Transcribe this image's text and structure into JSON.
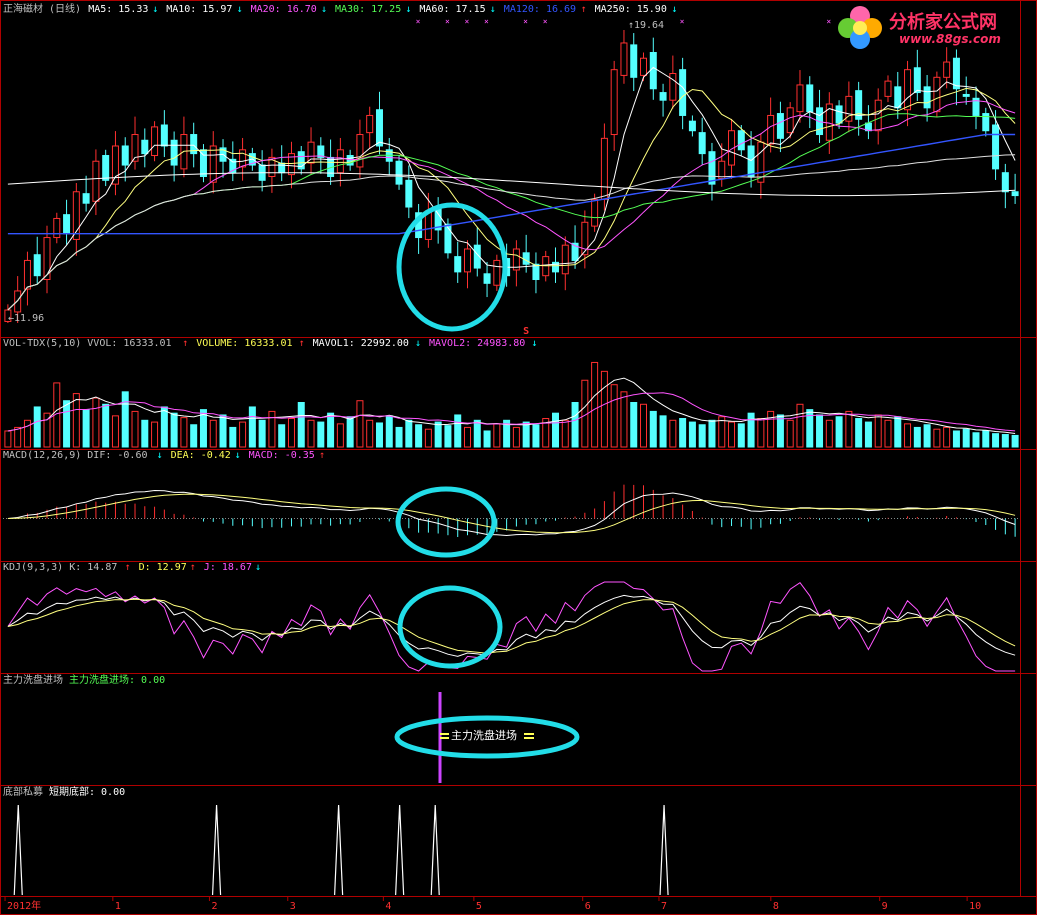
{
  "panels": {
    "price": {
      "legend": [
        {
          "text": "正海磁材 (日线)",
          "color": "#c0c0c0"
        },
        {
          "text": "MA5: 15.33",
          "color": "#ffffff",
          "arrow": "↓",
          "arrow_color": "#00ffff"
        },
        {
          "text": "MA10: 15.97",
          "color": "#ffffff",
          "arrow": "↓",
          "arrow_color": "#00ffff"
        },
        {
          "text": "MA20: 16.70",
          "color": "#ff55ff",
          "arrow": "↓",
          "arrow_color": "#00ffff"
        },
        {
          "text": "MA30: 17.25",
          "color": "#55ff55",
          "arrow": "↓",
          "arrow_color": "#00ffff"
        },
        {
          "text": "MA60: 17.15",
          "color": "#ffffff",
          "arrow": "↓",
          "arrow_color": "#00ffff"
        },
        {
          "text": "MA120: 16.69",
          "color": "#3355ff",
          "arrow": "↑",
          "arrow_color": "#ff3030"
        },
        {
          "text": "MA250: 15.90",
          "color": "#ffffff",
          "arrow": "↓",
          "arrow_color": "#00ffff"
        }
      ],
      "high_label": "19.64",
      "low_label": "11.96",
      "signal_mark": "S"
    },
    "volume": {
      "legend": [
        {
          "text": "VOL-TDX(5,10) VVOL: 16333.01",
          "color": "#c0c0c0",
          "arrow": "↑",
          "arrow_color": "#ff3030"
        },
        {
          "text": "VOLUME: 16333.01",
          "color": "#ffff55",
          "arrow": "↑",
          "arrow_color": "#ff3030"
        },
        {
          "text": "MAVOL1: 22992.00",
          "color": "#ffffff",
          "arrow": "↓",
          "arrow_color": "#00ffff"
        },
        {
          "text": "MAVOL2: 24983.80",
          "color": "#ff55ff",
          "arrow": "↓",
          "arrow_color": "#00ffff"
        }
      ]
    },
    "macd": {
      "legend": [
        {
          "text": "MACD(12,26,9) DIF: -0.60",
          "color": "#c0c0c0",
          "arrow": "↓",
          "arrow_color": "#00ffff"
        },
        {
          "text": "DEA: -0.42",
          "color": "#ffff55",
          "arrow": "↓",
          "arrow_color": "#00ffff"
        },
        {
          "text": "MACD: -0.35",
          "color": "#ff55ff",
          "arrow": "↑",
          "arrow_color": "#ff3030"
        }
      ]
    },
    "kdj": {
      "legend": [
        {
          "text": "KDJ(9,3,3) K: 14.87",
          "color": "#c0c0c0",
          "arrow": "↑",
          "arrow_color": "#ff3030"
        },
        {
          "text": "D: 12.97",
          "color": "#ffff55",
          "arrow": "↑",
          "arrow_color": "#ff3030"
        },
        {
          "text": "J: 18.67",
          "color": "#ff55ff",
          "arrow": "↓",
          "arrow_color": "#00ffff"
        }
      ]
    },
    "wash": {
      "legend": [
        {
          "text": "主力洗盘进场",
          "color": "#c0c0c0"
        },
        {
          "text": "主力洗盘进场: 0.00",
          "color": "#55ff55"
        }
      ],
      "signal_text": "主力洗盘进场"
    },
    "bottom": {
      "legend": [
        {
          "text": "底部私募",
          "color": "#c0c0c0"
        },
        {
          "text": "短期底部: 0.00",
          "color": "#ffffff"
        }
      ]
    }
  },
  "x_axis": [
    "2012年",
    "1",
    "2",
    "3",
    "4",
    "5",
    "6",
    "7",
    "8",
    "9",
    "10"
  ],
  "logo": {
    "main": "分析家公式网",
    "sub": "www.88gs.com"
  },
  "colors": {
    "up": "#ff3030",
    "down": "#54ffff",
    "frame": "#b00000",
    "highlight": "#22dde8"
  },
  "chart_data": [
    {
      "type": "candlestick",
      "title": "正海磁材 (日线)",
      "ylim": [
        11.96,
        19.64
      ],
      "close": [
        12.3,
        12.8,
        13.6,
        13.2,
        14.2,
        14.7,
        14.3,
        15.4,
        15.1,
        16.2,
        15.7,
        16.6,
        16.1,
        16.9,
        16.4,
        17.1,
        16.6,
        16.1,
        16.9,
        16.4,
        15.8,
        16.6,
        16.2,
        15.9,
        16.5,
        16.1,
        15.7,
        16.3,
        15.9,
        16.4,
        16.0,
        16.7,
        16.3,
        15.8,
        16.5,
        16.1,
        16.9,
        17.4,
        16.6,
        16.2,
        15.6,
        15.0,
        14.2,
        14.9,
        14.4,
        13.8,
        13.3,
        13.9,
        13.4,
        13.0,
        13.6,
        13.2,
        13.9,
        13.5,
        13.1,
        13.7,
        13.3,
        14.0,
        13.6,
        14.6,
        15.2,
        16.8,
        18.6,
        19.3,
        18.4,
        18.9,
        18.1,
        17.8,
        18.5,
        17.4,
        17.0,
        16.4,
        15.6,
        16.2,
        17.0,
        16.5,
        15.8,
        16.7,
        17.4,
        16.8,
        17.6,
        18.2,
        17.5,
        16.9,
        17.7,
        17.2,
        17.9,
        17.3,
        17.0,
        17.8,
        18.3,
        17.6,
        18.6,
        18.0,
        17.6,
        18.4,
        18.8,
        18.1,
        17.9,
        17.4,
        17.0,
        16.0,
        15.4,
        15.3
      ],
      "ma_legend": {
        "MA5": 15.33,
        "MA10": 15.97,
        "MA20": 16.7,
        "MA30": 17.25,
        "MA60": 17.15,
        "MA120": 16.69,
        "MA250": 15.9
      }
    },
    {
      "type": "bar",
      "title": "VOL-TDX(5,10)",
      "values": [
        0.18,
        0.22,
        0.3,
        0.45,
        0.38,
        0.72,
        0.52,
        0.6,
        0.42,
        0.55,
        0.48,
        0.35,
        0.62,
        0.4,
        0.3,
        0.28,
        0.45,
        0.38,
        0.33,
        0.25,
        0.42,
        0.3,
        0.36,
        0.22,
        0.28,
        0.45,
        0.3,
        0.4,
        0.25,
        0.32,
        0.5,
        0.3,
        0.28,
        0.38,
        0.26,
        0.34,
        0.52,
        0.3,
        0.27,
        0.35,
        0.22,
        0.3,
        0.25,
        0.2,
        0.28,
        0.24,
        0.36,
        0.22,
        0.3,
        0.18,
        0.26,
        0.3,
        0.22,
        0.28,
        0.25,
        0.32,
        0.38,
        0.3,
        0.5,
        0.75,
        0.95,
        0.85,
        0.7,
        0.62,
        0.5,
        0.48,
        0.4,
        0.35,
        0.3,
        0.32,
        0.28,
        0.25,
        0.3,
        0.34,
        0.28,
        0.26,
        0.38,
        0.32,
        0.4,
        0.36,
        0.3,
        0.48,
        0.42,
        0.36,
        0.3,
        0.34,
        0.4,
        0.32,
        0.28,
        0.36,
        0.3,
        0.34,
        0.26,
        0.22,
        0.25,
        0.2,
        0.22,
        0.18,
        0.2,
        0.16,
        0.18,
        0.15,
        0.14,
        0.13
      ],
      "legend": {
        "VVOL": 16333.01,
        "VOLUME": 16333.01,
        "MAVOL1": 22992.0,
        "MAVOL2": 24983.8
      }
    },
    {
      "type": "bar",
      "title": "MACD(12,26,9)",
      "legend": {
        "DIF": -0.6,
        "DEA": -0.42,
        "MACD": -0.35
      }
    },
    {
      "type": "line",
      "title": "KDJ(9,3,3)",
      "legend": {
        "K": 14.87,
        "D": 12.97,
        "J": 18.67
      }
    },
    {
      "type": "bar",
      "title": "底部私募",
      "spike_positions": [
        0.015,
        0.21,
        0.33,
        0.39,
        0.425,
        0.65
      ],
      "legend": {
        "短期底部": 0.0
      }
    }
  ]
}
